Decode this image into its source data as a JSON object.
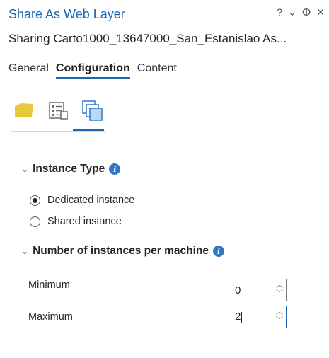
{
  "header": {
    "title": "Share As Web Layer",
    "subtitle": "Sharing Carto1000_13647000_San_Estanislao As...",
    "controls": {
      "help": "?",
      "menu": "⌄",
      "pin": "ⵀ",
      "close": "✕"
    }
  },
  "tabs": [
    {
      "label": "General",
      "active": false
    },
    {
      "label": "Configuration",
      "active": true
    },
    {
      "label": "Content",
      "active": false
    }
  ],
  "subtabs": [
    {
      "icon": "layer-folder-icon",
      "active": false
    },
    {
      "icon": "properties-list-icon",
      "active": false
    },
    {
      "icon": "stacked-pages-icon",
      "active": true
    }
  ],
  "instance_type": {
    "heading": "Instance Type",
    "options": [
      {
        "label": "Dedicated instance",
        "checked": true
      },
      {
        "label": "Shared instance",
        "checked": false
      }
    ]
  },
  "instances_per_machine": {
    "heading": "Number of instances per machine",
    "minimum": {
      "label": "Minimum",
      "value": "0"
    },
    "maximum": {
      "label": "Maximum",
      "value": "2"
    }
  },
  "colors": {
    "accent": "#1a66b5",
    "info": "#2f78c4",
    "folder": "#e8c93c"
  }
}
